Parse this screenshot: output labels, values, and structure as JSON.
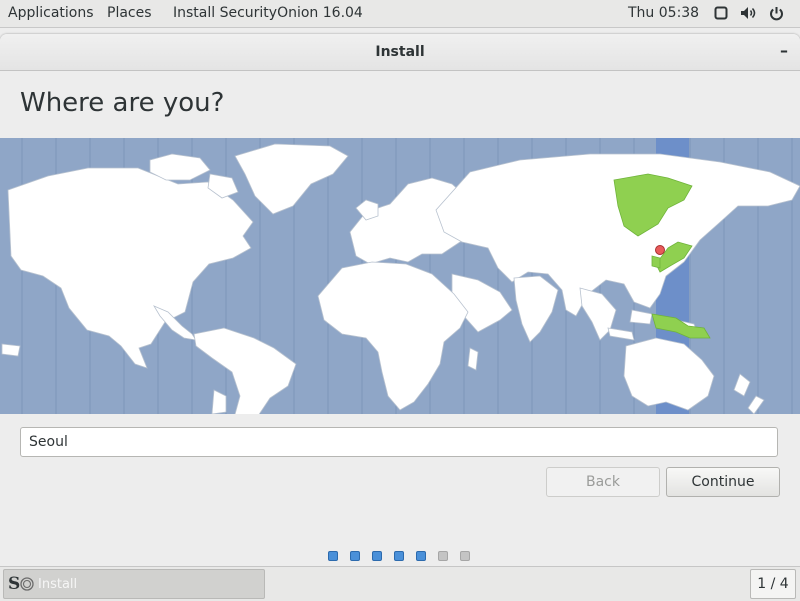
{
  "topbar": {
    "applications": "Applications",
    "places": "Places",
    "app_menu": "Install SecurityOnion 16.04",
    "clock": "Thu 05:38"
  },
  "window": {
    "title": "Install",
    "minimize": "–"
  },
  "page": {
    "heading": "Where are you?",
    "city_value": "Seoul",
    "back_label": "Back",
    "continue_label": "Continue",
    "progress": {
      "total": 7,
      "completed": 5
    }
  },
  "taskbar": {
    "logo": "S",
    "task_label": "Install",
    "workspace": "1 / 4"
  },
  "map": {
    "selected_city": "Seoul",
    "highlighted_timezone": "UTC+9",
    "colors": {
      "ocean": "#8fa6c7",
      "land": "#ffffff",
      "band": "#6d8fc9",
      "highlight": "#8fd050",
      "marker": "#e85a5a"
    }
  },
  "colors": {
    "accent": "#4a90d9"
  }
}
